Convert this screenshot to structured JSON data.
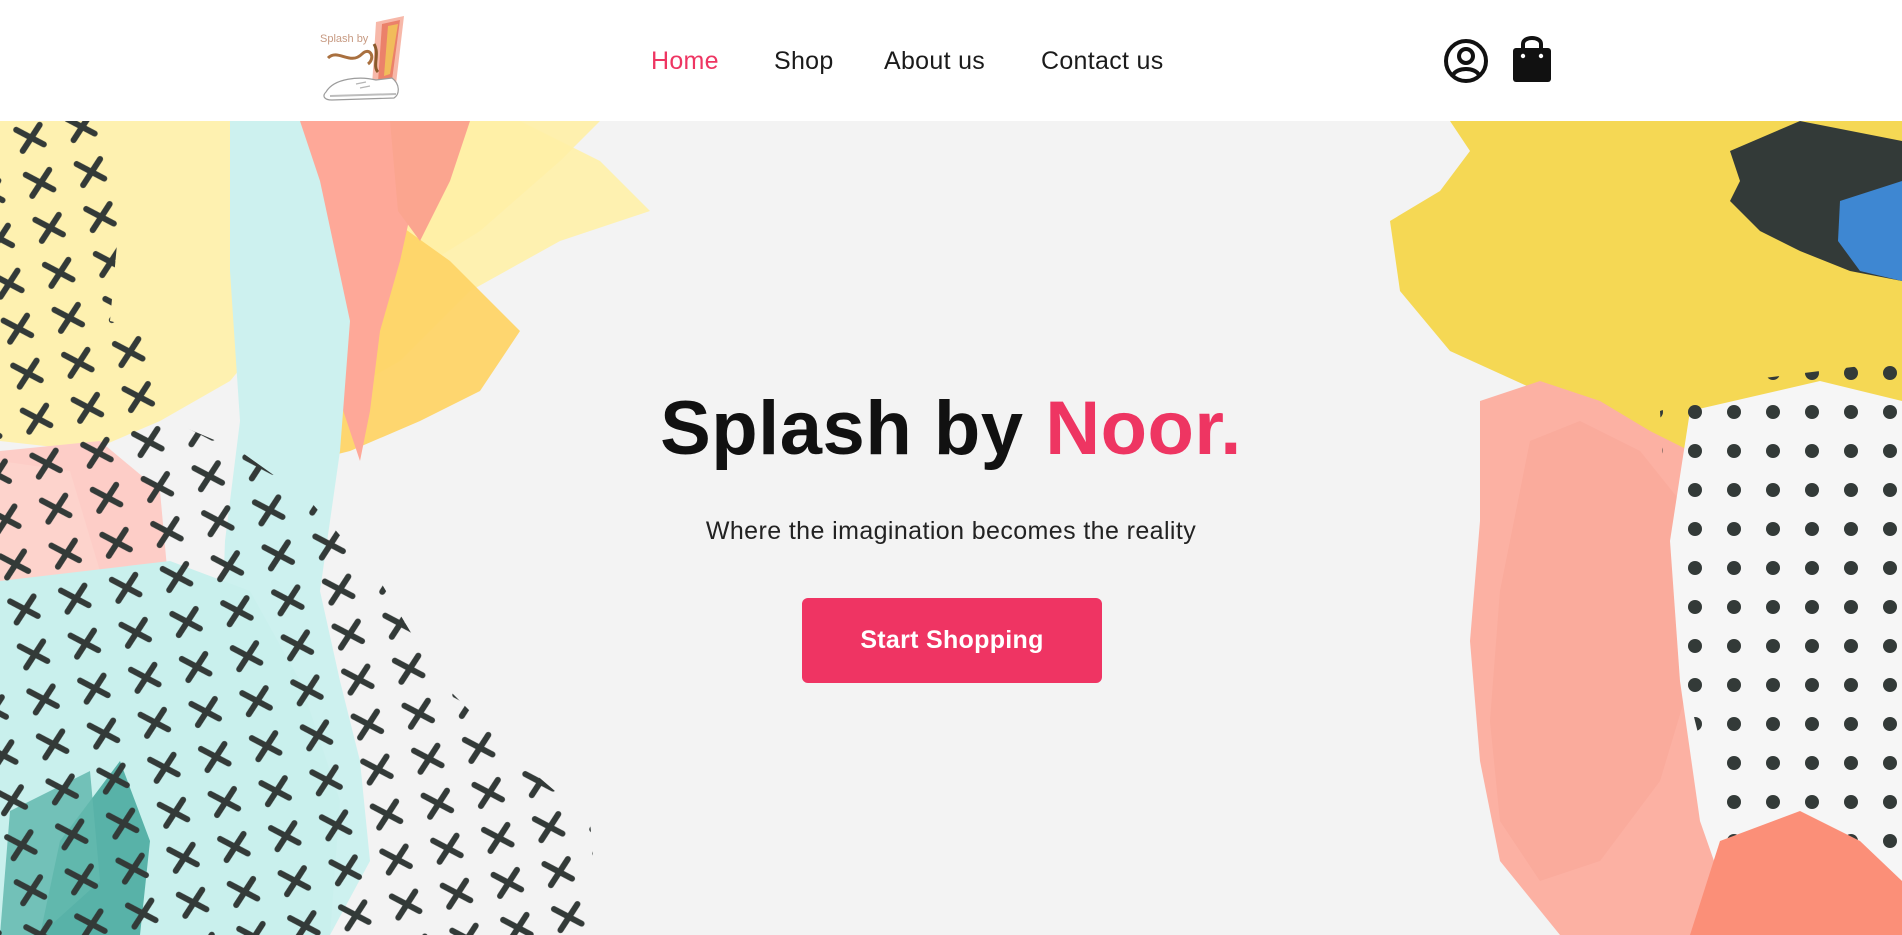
{
  "brand": {
    "logo_text": "Splash by",
    "logo_icon": "sneaker-logo",
    "accent_color": "#ee3562"
  },
  "nav": {
    "items": [
      {
        "label": "Home",
        "active": true
      },
      {
        "label": "Shop",
        "active": false
      },
      {
        "label": "About us",
        "active": false
      },
      {
        "label": "Contact us",
        "active": false
      }
    ]
  },
  "header_icons": {
    "account": "user-circle-icon",
    "cart": "shopping-bag-icon"
  },
  "hero": {
    "title_main": "Splash by ",
    "title_accent": "Noor.",
    "subtitle": "Where the imagination becomes the reality",
    "cta_label": "Start Shopping",
    "background_color": "#f3f3f3"
  }
}
